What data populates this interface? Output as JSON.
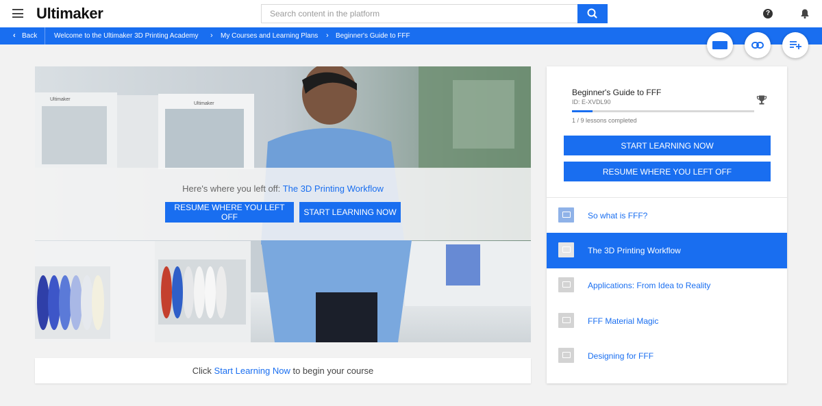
{
  "topbar": {
    "logo": "Ultimaker",
    "search_placeholder": "Search content in the platform"
  },
  "breadcrumb": {
    "back_label": "Back",
    "items": [
      "Welcome to the Ultimaker 3D Printing Academy",
      "My Courses and Learning Plans",
      "Beginner's Guide to FFF"
    ]
  },
  "hero": {
    "left_off_prefix": "Here's where you left off:",
    "left_off_lesson": "The 3D Printing Workflow",
    "resume_label": "RESUME WHERE YOU LEFT OFF",
    "start_label": "START LEARNING NOW",
    "filament_brand": "Ultimaker"
  },
  "hint": {
    "prefix": "Click",
    "link": "Start Learning Now",
    "suffix": "to begin your course"
  },
  "course": {
    "title": "Beginner's Guide to FFF",
    "id_label": "ID: E-XVDL90",
    "progress_fraction": 0.111,
    "progress_text": "1 / 9 lessons completed",
    "start_label": "START LEARNING NOW",
    "resume_label": "RESUME WHERE YOU LEFT OFF"
  },
  "lessons": [
    {
      "label": "So what is FFF?"
    },
    {
      "label": "The 3D Printing Workflow"
    },
    {
      "label": "Applications: From Idea to Reality"
    },
    {
      "label": "FFF Material Magic"
    },
    {
      "label": "Designing for FFF"
    }
  ],
  "colors": {
    "accent": "#196ef0",
    "background": "#f2f2f2"
  },
  "icons": [
    "menu-icon",
    "search-icon",
    "help-icon",
    "bell-icon",
    "back-chevron-icon",
    "fullscreen-icon",
    "link-icon",
    "add-to-playlist-icon",
    "trophy-icon",
    "lesson-monitor-icon"
  ]
}
